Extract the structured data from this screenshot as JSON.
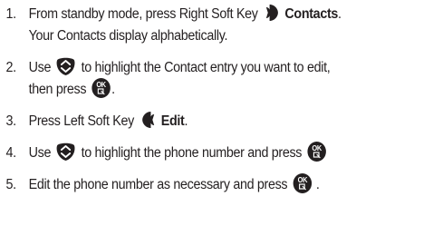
{
  "steps": [
    {
      "number": "1.",
      "line1_a": "From standby mode, press Right Soft Key",
      "line1_b": "Contacts",
      "line1_c": ".",
      "line2": "Your Contacts display alphabetically.",
      "icons": [
        "right-soft-key-icon"
      ]
    },
    {
      "number": "2.",
      "line1_a": "Use",
      "line1_b": "to highlight the Contact entry you want to edit,",
      "line2_a": "then press",
      "line2_b": ".",
      "icons": [
        "navigation-key-icon",
        "ok-key-icon"
      ]
    },
    {
      "number": "3.",
      "text_a": "Press Left Soft Key",
      "text_b": "Edit",
      "text_c": ".",
      "icons": [
        "left-soft-key-icon"
      ]
    },
    {
      "number": "4.",
      "text_a": "Use",
      "text_b": "to highlight the phone number and press",
      "icons": [
        "navigation-key-icon",
        "ok-key-icon"
      ]
    },
    {
      "number": "5.",
      "text_a": "Edit the phone number as necessary and press",
      "text_b": ".",
      "icons": [
        "ok-key-icon"
      ]
    }
  ],
  "ok_key": {
    "top": "OK",
    "bottom": "⎘"
  },
  "colors": {
    "text": "#231f20",
    "key": "#231f20",
    "key_mark": "#ffffff"
  }
}
